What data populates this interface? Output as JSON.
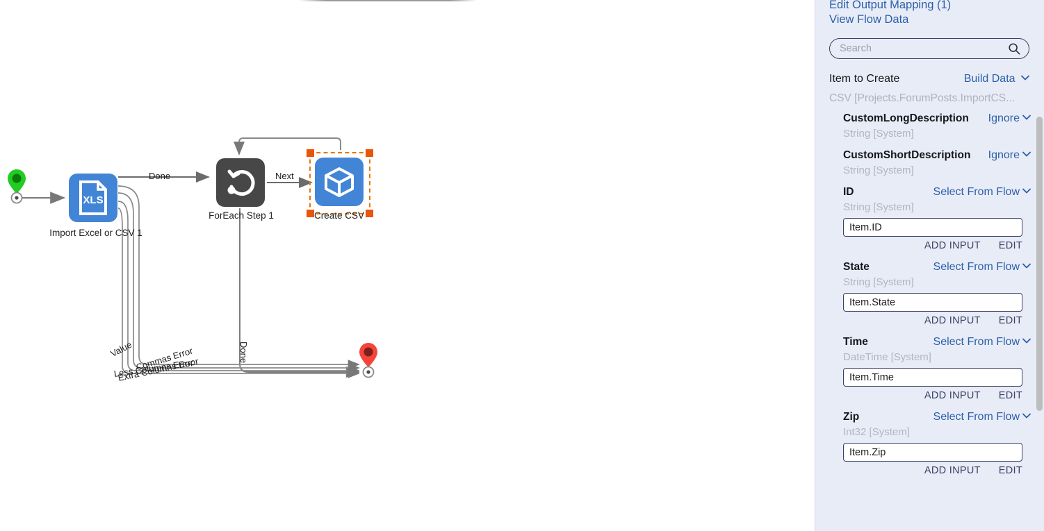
{
  "canvas": {
    "nodes": [
      {
        "id": "start",
        "type": "start-pin",
        "label": ""
      },
      {
        "id": "import",
        "type": "xls",
        "label": "Import Excel or CSV 1",
        "icon": "xls-file-icon",
        "icon_text": "XLS"
      },
      {
        "id": "foreach",
        "type": "loop",
        "label": "ForEach Step 1",
        "icon": "loop-arrow-icon"
      },
      {
        "id": "createcsv",
        "type": "cube",
        "label": "Create CSV",
        "icon": "cube-icon",
        "selected": true
      },
      {
        "id": "end",
        "type": "end-pin",
        "label": ""
      }
    ],
    "edge_labels": {
      "done_top": "Done",
      "next": "Next",
      "done_vertical": "Done",
      "value": "Value",
      "commas_error": "Commas Error",
      "less_columns_error": "Less Columns Error",
      "extra_columns_error": "Extra Columns Error"
    }
  },
  "panel": {
    "links": {
      "edit_output_mapping": "Edit Output Mapping (1)",
      "view_flow_data": "View Flow Data"
    },
    "search": {
      "placeholder": "Search",
      "value": "",
      "icon": "search-icon"
    },
    "item_to_create": {
      "label": "Item to Create",
      "action": "Build Data",
      "subtitle": "CSV [Projects.ForumPosts.ImportCS..."
    },
    "actions": {
      "add_input": "ADD INPUT",
      "edit": "EDIT"
    },
    "properties": [
      {
        "name": "CustomLongDescription",
        "mode": "Ignore",
        "type": "String [System]",
        "has_input": false
      },
      {
        "name": "CustomShortDescription",
        "mode": "Ignore",
        "type": "String [System]",
        "has_input": false
      },
      {
        "name": "ID",
        "mode": "Select From Flow",
        "type": "String [System]",
        "has_input": true,
        "value": "Item.ID"
      },
      {
        "name": "State",
        "mode": "Select From Flow",
        "type": "String [System]",
        "has_input": true,
        "value": "Item.State"
      },
      {
        "name": "Time",
        "mode": "Select From Flow",
        "type": "DateTime [System]",
        "has_input": true,
        "value": "Item.Time"
      },
      {
        "name": "Zip",
        "mode": "Select From Flow",
        "type": "Int32 [System]",
        "has_input": true,
        "value": "Item.Zip"
      }
    ]
  },
  "colors": {
    "panel_background": "#e8ecf7",
    "link_blue": "#2b5fa8",
    "node_blue": "#4285d6",
    "node_dark": "#474747",
    "selection_orange": "#e8760c",
    "start_green": "#22cc22",
    "end_red": "#f4443c"
  }
}
